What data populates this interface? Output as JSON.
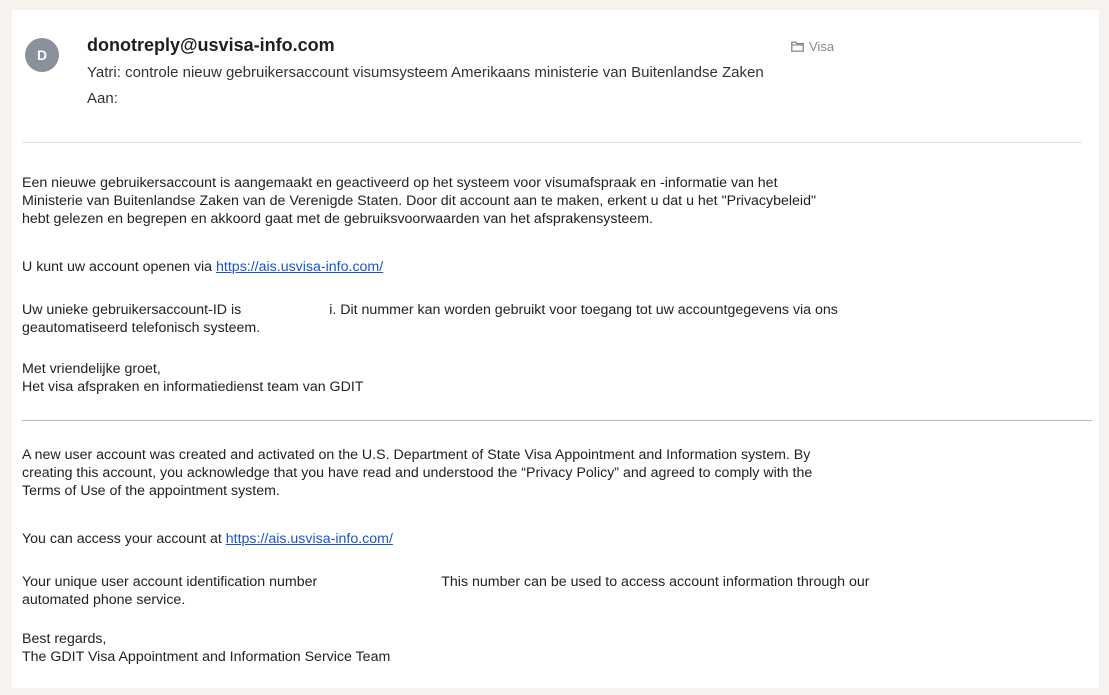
{
  "header": {
    "avatar_letter": "D",
    "from": "donotreply@usvisa-info.com",
    "folder": "Visa",
    "subject": "Yatri: controle nieuw gebruikersaccount visumsysteem Amerikaans ministerie van Buitenlandse Zaken",
    "to_label": "Aan:"
  },
  "dutch": {
    "para1_line1": "Een nieuwe gebruikersaccount is aangemaakt en geactiveerd op het systeem voor visumafspraak en -informatie van het",
    "para1_line2": "Ministerie van Buitenlandse Zaken van de Verenigde Staten. Door dit account aan te maken, erkent u dat u het \"Privacybeleid\"",
    "para1_line3": "hebt gelezen en begrepen en akkoord gaat met de gebruiksvoorwaarden van het afsprakensysteem.",
    "para2_prefix": "U kunt uw account openen via ",
    "link": "https://ais.usvisa-info.com/",
    "para3_prefix": "Uw unieke gebruikersaccount-ID is",
    "para3_suffix": "i. Dit nummer kan worden gebruikt voor toegang tot uw accountgegevens via ons",
    "para3_line2": "geautomatiseerd telefonisch systeem.",
    "closing": "Met vriendelijke groet,",
    "signature": "Het visa afspraken en informatiedienst team van GDIT"
  },
  "english": {
    "para1_line1": "A new user account was created and activated on the U.S. Department of State Visa Appointment and Information system. By",
    "para1_line2": "creating this account, you acknowledge that you have read and understood the “Privacy Policy” and agreed to comply with the",
    "para1_line3": "Terms of Use of the appointment system.",
    "para2_prefix": "You can access your account at ",
    "link": "https://ais.usvisa-info.com/",
    "para3_prefix": "Your unique user account identification number",
    "para3_suffix": "This number can be used to access account information through our",
    "para3_line2": "automated phone service.",
    "closing": "Best regards,",
    "signature": "The GDIT Visa Appointment and Information Service Team"
  },
  "colors": {
    "link": "#1a55c8",
    "avatar_bg": "#8a919c",
    "page_bg": "#f6f3ee"
  }
}
